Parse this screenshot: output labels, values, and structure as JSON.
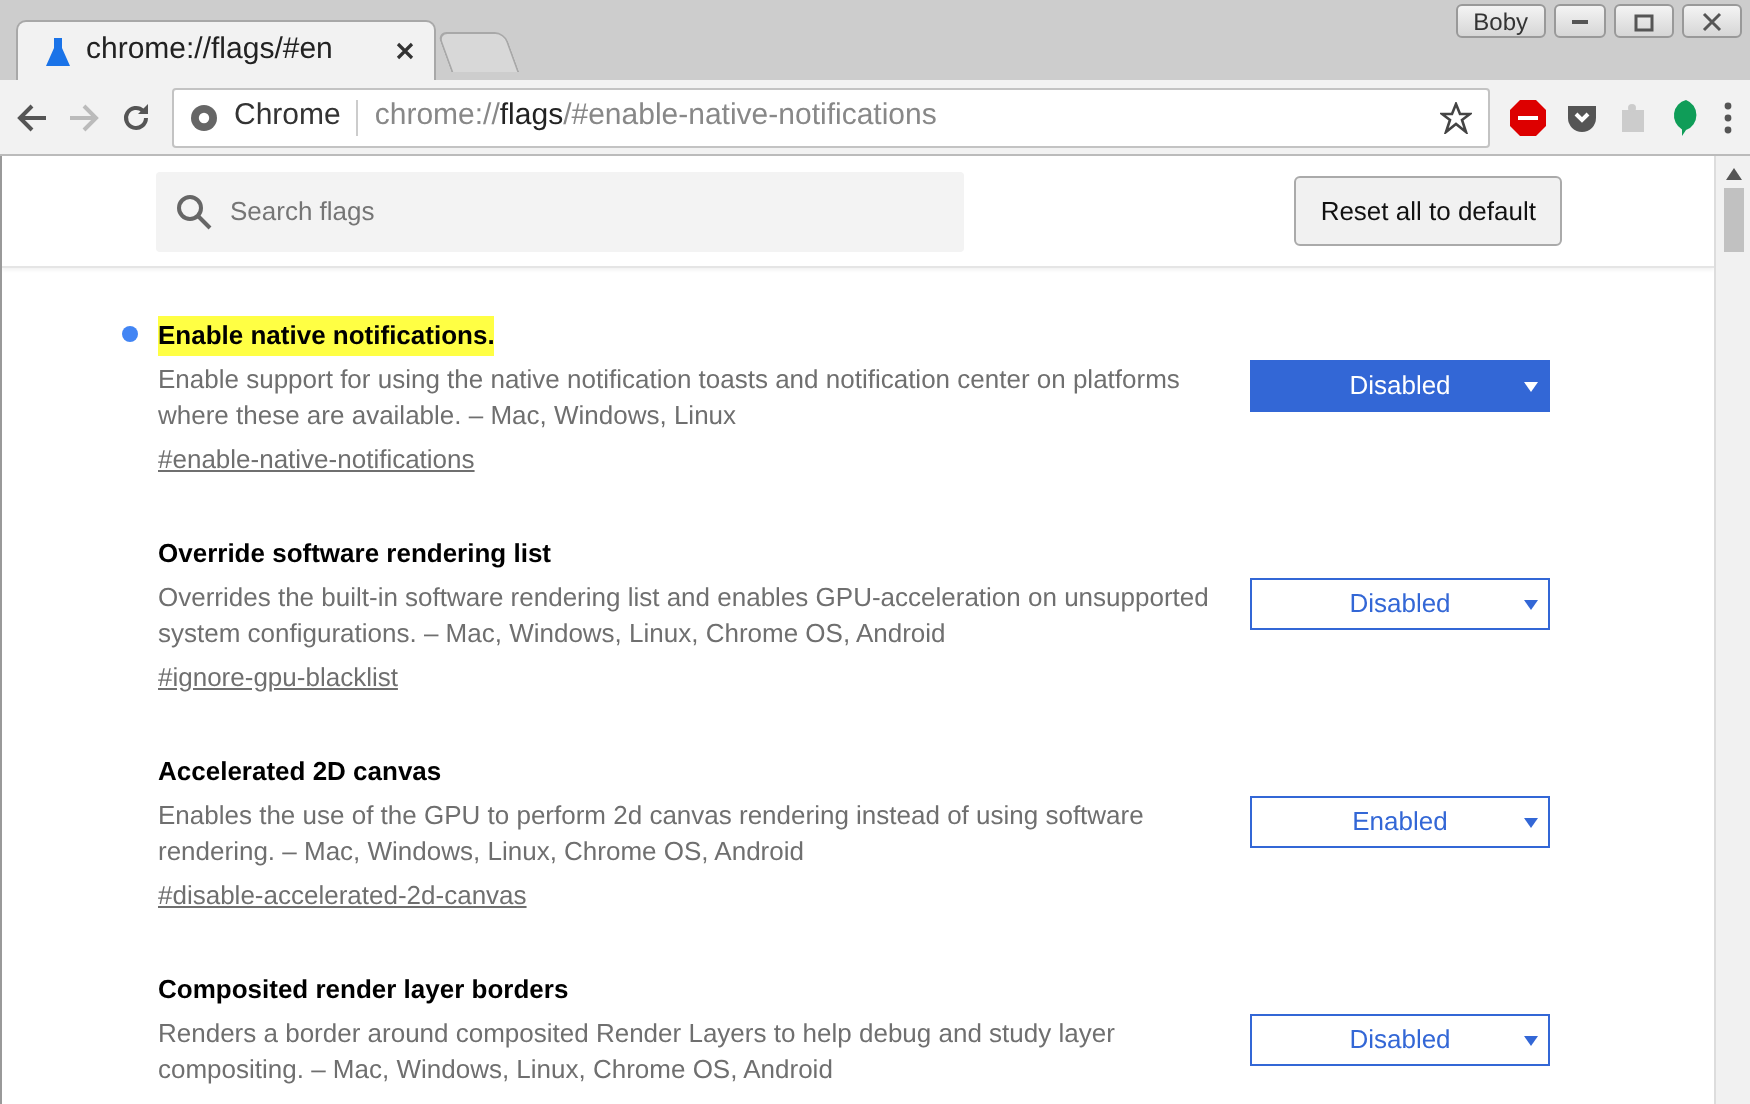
{
  "window": {
    "user": "Boby"
  },
  "tabs": [
    {
      "title": "chrome://flags/#en",
      "selected": true
    },
    {
      "selected": false
    }
  ],
  "toolbar": {
    "site": "Chrome",
    "url_prefix": "chrome://",
    "url_host": "flags",
    "url_rest": "/#enable-native-notifications"
  },
  "search": {
    "placeholder": "Search flags"
  },
  "reset_button": "Reset all to default",
  "flags": [
    {
      "title": "Enable native notifications.",
      "highlighted": true,
      "description": "Enable support for using the native notification toasts and notification center on platforms where these are available. – Mac, Windows, Linux",
      "anchor": "#enable-native-notifications",
      "value": "Disabled",
      "modified": true
    },
    {
      "title": "Override software rendering list",
      "highlighted": false,
      "description": "Overrides the built-in software rendering list and enables GPU-acceleration on unsupported system configurations. – Mac, Windows, Linux, Chrome OS, Android",
      "anchor": "#ignore-gpu-blacklist",
      "value": "Disabled",
      "modified": false
    },
    {
      "title": "Accelerated 2D canvas",
      "highlighted": false,
      "description": "Enables the use of the GPU to perform 2d canvas rendering instead of using software rendering. – Mac, Windows, Linux, Chrome OS, Android",
      "anchor": "#disable-accelerated-2d-canvas",
      "value": "Enabled",
      "modified": false
    },
    {
      "title": "Composited render layer borders",
      "highlighted": false,
      "description": "Renders a border around composited Render Layers to help debug and study layer compositing. – Mac, Windows, Linux, Chrome OS, Android",
      "value": "Disabled",
      "modified": false
    }
  ]
}
